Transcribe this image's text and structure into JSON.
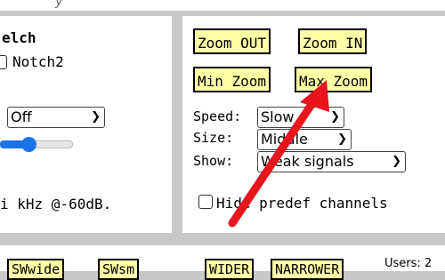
{
  "top_fragment": "y",
  "left_panel": {
    "squelch_label": "elch",
    "notch2_label": "Notch2",
    "mode_select_value": "Off",
    "status_text": "i kHz @-60dB."
  },
  "right_panel": {
    "zoom_out_label": "Zoom OUT",
    "zoom_in_label": "Zoom IN",
    "min_zoom_label": "Min Zoom",
    "max_zoom_label": "Max Zoom",
    "speed_label": "Speed:",
    "speed_value": "Slow",
    "size_label": "Size:",
    "size_value": "Middle",
    "show_label": "Show:",
    "show_value": "Weak signals",
    "hide_predef_label": "Hide predef channels"
  },
  "bottom_panel": {
    "button1_label": "SWwide",
    "button2_label": "SWsm",
    "wider_label": "WIDER",
    "narrower_label": "NARROWER",
    "users_text": "Users: 2"
  },
  "colors": {
    "panel_bg": "#ffffff",
    "page_bg": "#c8c8c8",
    "button_yellow": "#ffffa8",
    "accent_blue": "#1a73e8",
    "arrow_red": "#e8141e"
  }
}
